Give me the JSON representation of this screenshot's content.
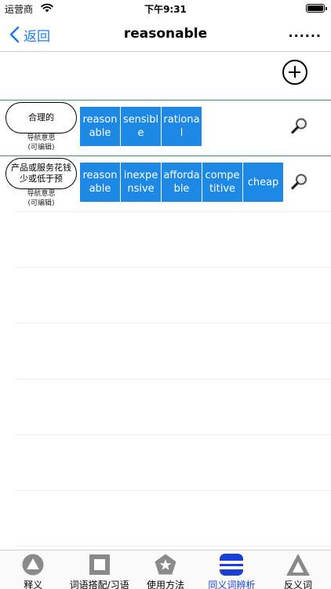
{
  "status_bar": {
    "carrier": "运营商",
    "time": "下午9:31"
  },
  "nav": {
    "back_label": "返回",
    "title": "reasonable",
    "more_label": "......"
  },
  "groups": [
    {
      "nav_label": "合理的",
      "caption": "导航意思\n(可编辑)",
      "words": [
        "reasonable",
        "sensible",
        "rational"
      ]
    },
    {
      "nav_label": "产品或服务花钱少或低于预",
      "caption": "导航意思\n(可编辑)",
      "words": [
        "reasonable",
        "inexpensive",
        "affordable",
        "competitive",
        "cheap"
      ]
    }
  ],
  "tabs": [
    {
      "label": "释义",
      "icon": "circle-icon",
      "active": false
    },
    {
      "label": "词语搭配/习语",
      "icon": "square-icon",
      "active": false
    },
    {
      "label": "使用方法",
      "icon": "star-pentagon-icon",
      "active": false
    },
    {
      "label": "同义词辨析",
      "icon": "synonym-bars-icon",
      "active": true
    },
    {
      "label": "反义词",
      "icon": "triangle-icon",
      "active": false
    }
  ],
  "colors": {
    "accent_blue": "#1a7cf5",
    "chip_blue": "#1e88e5",
    "active_tab": "#1a3fd6",
    "divider_green": "#3e9a62",
    "icon_gray": "#8a8a8a"
  }
}
